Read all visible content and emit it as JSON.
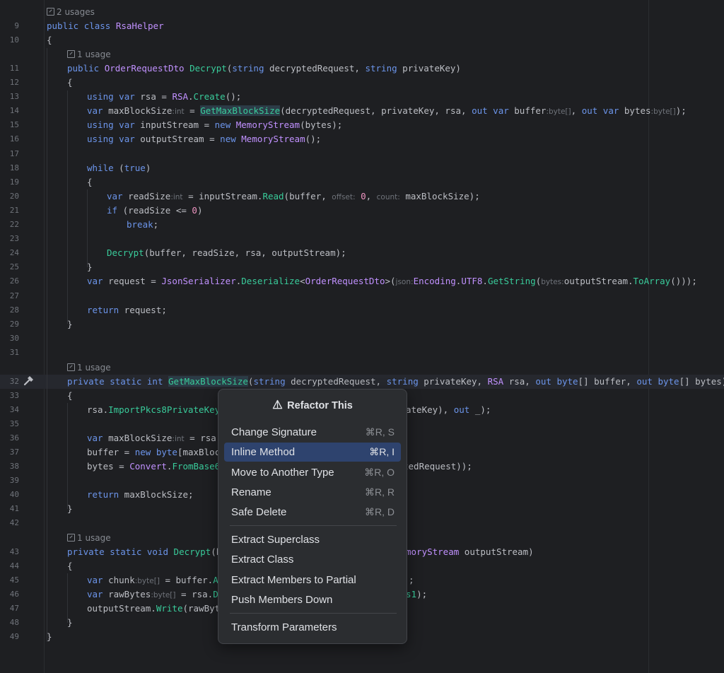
{
  "colors": {
    "background": "#1e1f22",
    "keyword": "#6c95eb",
    "type": "#c191ff",
    "method": "#39cc9b",
    "number": "#ed94c0",
    "plain": "#bcbec4",
    "popup_bg": "#2b2d30",
    "selection": "#2e436e"
  },
  "usages": {
    "class": "2 usages",
    "decrypt": "1 usage",
    "get_max": "1 usage",
    "decrypt_private": "1 usage"
  },
  "line_numbers": [
    "9",
    "10",
    "11",
    "12",
    "13",
    "14",
    "15",
    "16",
    "17",
    "18",
    "19",
    "20",
    "21",
    "22",
    "23",
    "24",
    "25",
    "26",
    "27",
    "28",
    "29",
    "30",
    "31",
    "32",
    "33",
    "34",
    "35",
    "36",
    "37",
    "38",
    "39",
    "40",
    "41",
    "42",
    "43",
    "44",
    "45",
    "46",
    "47",
    "48",
    "49"
  ],
  "gutter_icon": "hammer-icon",
  "code": {
    "l9": {
      "a": "public",
      "b": "class",
      "c": "RsaHelper"
    },
    "l10": {
      "a": "{"
    },
    "l11": {
      "a": "public",
      "b": "OrderRequestDto",
      "c": "Decrypt",
      "d": "(",
      "e": "string",
      "f": " decryptedRequest, ",
      "g": "string",
      "h": " privateKey)"
    },
    "l12": {
      "a": "{"
    },
    "l13": {
      "a": "using",
      "b": "var",
      "c": " rsa = ",
      "d": "RSA",
      "e": ".",
      "f": "Create",
      "g": "();"
    },
    "l14": {
      "a": "var",
      "b": " maxBlockSize",
      "h1": ":int",
      "c": " = ",
      "d": "GetMaxBlockSize",
      "e": "(decryptedRequest, privateKey, rsa, ",
      "f": "out",
      "g": "var",
      "i": " buffer",
      "h2": ":byte[]",
      "j": ", ",
      "k": "out",
      "l": "var",
      "m": " bytes",
      "h3": ":byte[]",
      "n": ");"
    },
    "l15": {
      "a": "using",
      "b": "var",
      "c": " inputStream = ",
      "d": "new",
      "e": "MemoryStream",
      "f": "(bytes);"
    },
    "l16": {
      "a": "using",
      "b": "var",
      "c": " outputStream = ",
      "d": "new",
      "e": "MemoryStream",
      "f": "();"
    },
    "l18": {
      "a": "while",
      "b": " (",
      "c": "true",
      "d": ")"
    },
    "l19": {
      "a": "{"
    },
    "l20": {
      "a": "var",
      "b": " readSize",
      "h1": ":int",
      "c": " = inputStream.",
      "d": "Read",
      "e": "(buffer, ",
      "h2": "offset:",
      "f": "0",
      "g": ", ",
      "h3": "count:",
      "i": "maxBlockSize);"
    },
    "l21": {
      "a": "if",
      "b": " (readSize <= ",
      "c": "0",
      "d": ")"
    },
    "l22": {
      "a": "break",
      "b": ";"
    },
    "l24": {
      "a": "Decrypt",
      "b": "(buffer, readSize, rsa, outputStream);"
    },
    "l25": {
      "a": "}"
    },
    "l26": {
      "a": "var",
      "b": " request = ",
      "c": "JsonSerializer",
      "d": ".",
      "e": "Deserialize",
      "f": "<",
      "g": "OrderRequestDto",
      "h": ">(",
      "h1": "json:",
      "i": "Encoding",
      "j": ".",
      "k": "UTF8",
      "l": ".",
      "m": "GetString",
      "n": "(",
      "h2": "bytes:",
      "o": "outputStream.",
      "p": "ToArray",
      "q": "()));"
    },
    "l28": {
      "a": "return",
      "b": " request;"
    },
    "l29": {
      "a": "}"
    },
    "l32": {
      "a": "private",
      "b": "static",
      "c": "int",
      "d": "GetMaxBlockSize",
      "e": "(",
      "f": "string",
      "g": " decryptedRequest, ",
      "h": "string",
      "i": " privateKey, ",
      "j": "RSA",
      "k": " rsa, ",
      "l": "out",
      "m": "byte",
      "n": "[] buffer, ",
      "o": "out",
      "p": "byte",
      "q": "[] bytes)"
    },
    "l33": {
      "a": "{"
    },
    "l34": {
      "a": "rsa.",
      "b": "ImportPkcs8PrivateKey",
      "c": "(",
      "d": "ateKey), ",
      "e": "out",
      "f": " _);"
    },
    "l36": {
      "a": "var",
      "b": " maxBlockSize",
      "h1": ":int",
      "c": " = rsa."
    },
    "l37": {
      "a": "buffer = ",
      "b": "new",
      "c": "byte",
      "d": "[maxBlock"
    },
    "l38": {
      "a": "bytes = ",
      "b": "Convert",
      "c": ".",
      "d": "FromBase64",
      "e": "tedRequest));"
    },
    "l40": {
      "a": "return",
      "b": " maxBlockSize;"
    },
    "l41": {
      "a": "}"
    },
    "l43": {
      "a": "private",
      "b": "static",
      "c": "void",
      "d": "Decrypt",
      "e": "(by",
      "f": "moryStream",
      "g": " outputStream)"
    },
    "l44": {
      "a": "{"
    },
    "l45": {
      "a": "var",
      "b": " chunk",
      "h1": ":byte[]",
      "c": " = buffer.",
      "d": "A",
      "e": ";"
    },
    "l46": {
      "a": "var",
      "b": " rawBytes",
      "h1": ":byte[]",
      "c": " = rsa.",
      "d": "De",
      "e": "s1",
      "f": ");"
    },
    "l47": {
      "a": "outputStream.",
      "b": "Write",
      "c": "(rawByte"
    },
    "l48": {
      "a": "}"
    },
    "l49": {
      "a": "}"
    }
  },
  "popup": {
    "icon": "refactor-icon",
    "title": "Refactor This",
    "items": [
      {
        "label": "Change Signature",
        "shortcut": "⌘R, S"
      },
      {
        "label": "Inline Method",
        "shortcut": "⌘R, I",
        "selected": true
      },
      {
        "label": "Move to Another Type",
        "shortcut": "⌘R, O"
      },
      {
        "label": "Rename",
        "shortcut": "⌘R, R"
      },
      {
        "label": "Safe Delete",
        "shortcut": "⌘R, D"
      },
      {
        "label": "Extract Superclass",
        "shortcut": ""
      },
      {
        "label": "Extract Class",
        "shortcut": ""
      },
      {
        "label": "Extract Members to Partial",
        "shortcut": ""
      },
      {
        "label": "Push Members Down",
        "shortcut": ""
      },
      {
        "label": "Transform Parameters",
        "shortcut": ""
      }
    ]
  }
}
